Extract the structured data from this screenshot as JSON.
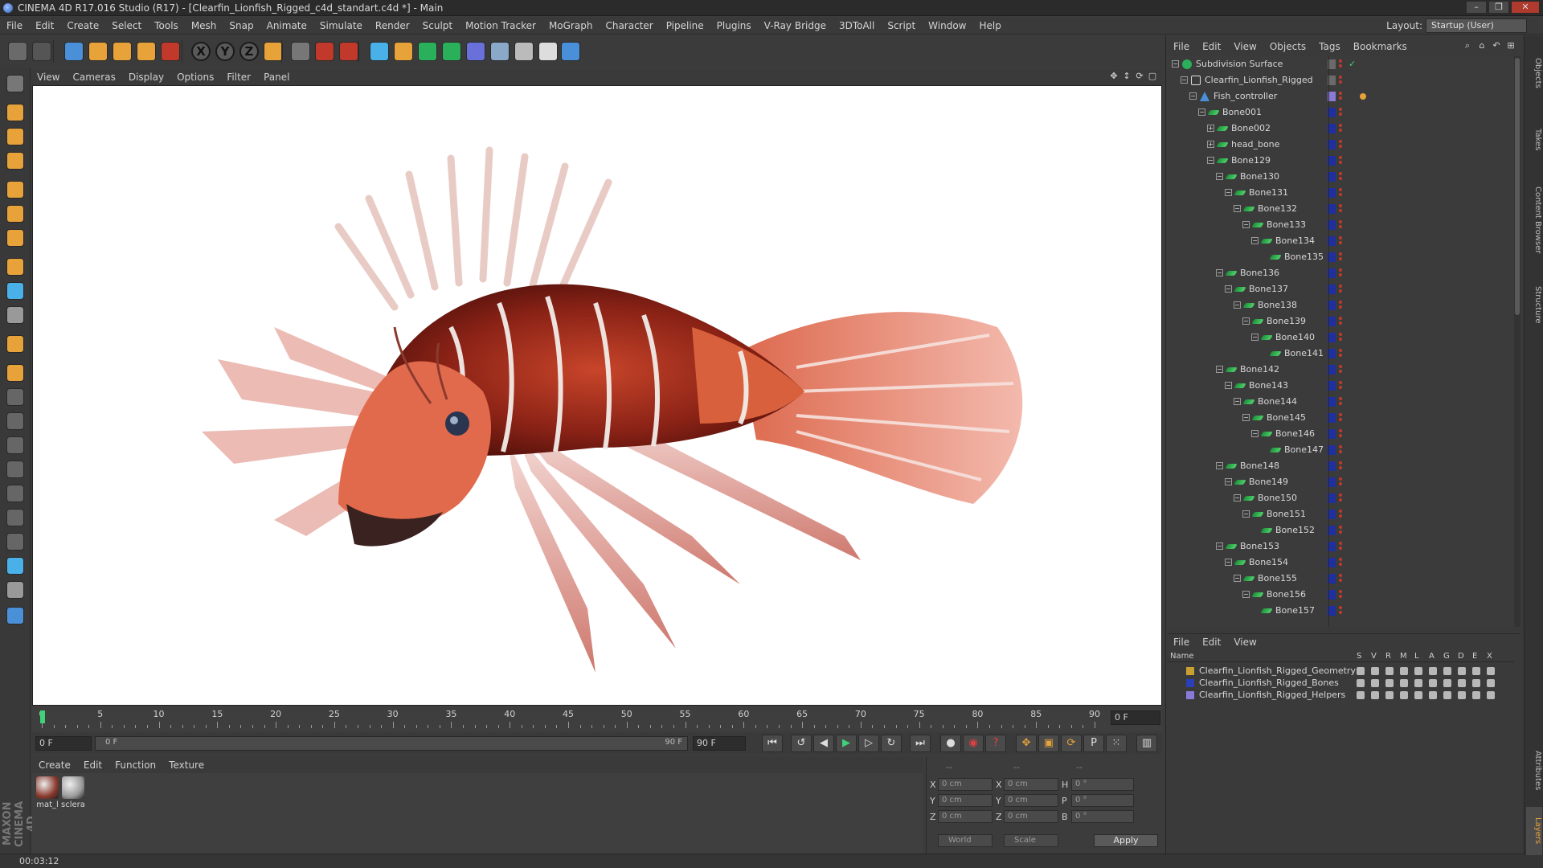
{
  "window": {
    "title": "CINEMA 4D R17.016 Studio (R17) - [Clearfin_Lionfish_Rigged_c4d_standart.c4d *] - Main",
    "buttons": [
      "–",
      "❐",
      "✕"
    ]
  },
  "menubar": {
    "items": [
      "File",
      "Edit",
      "Create",
      "Select",
      "Tools",
      "Mesh",
      "Snap",
      "Animate",
      "Simulate",
      "Render",
      "Sculpt",
      "Motion Tracker",
      "MoGraph",
      "Character",
      "Pipeline",
      "Plugins",
      "V-Ray Bridge",
      "3DToAll",
      "Script",
      "Window",
      "Help"
    ],
    "layout_label": "Layout:",
    "layout_value": "Startup (User)"
  },
  "toolbar": {
    "axis_x": "X",
    "axis_y": "Y",
    "axis_z": "Z"
  },
  "viewport": {
    "menu": [
      "View",
      "Cameras",
      "Display",
      "Options",
      "Filter",
      "Panel"
    ]
  },
  "timeline": {
    "ticks": [
      "0",
      "5",
      "10",
      "15",
      "20",
      "25",
      "30",
      "35",
      "40",
      "45",
      "50",
      "55",
      "60",
      "65",
      "70",
      "75",
      "80",
      "85",
      "90"
    ],
    "current_frame": "0 F",
    "start_field": "0 F",
    "range_start": "0 F",
    "range_end": "90 F",
    "end_field": "90 F"
  },
  "material_manager": {
    "menu": [
      "Create",
      "Edit",
      "Function",
      "Texture"
    ],
    "materials": [
      {
        "label": "mat_l",
        "color": "#8a3a2e"
      },
      {
        "label": "sclera",
        "color": "#9a9a9a"
      }
    ]
  },
  "coordinates": {
    "header": [
      "--",
      "--",
      "--"
    ],
    "rows": [
      {
        "a": "X",
        "av": "0 cm",
        "b": "X",
        "bv": "0 cm",
        "c": "H",
        "cv": "0 °"
      },
      {
        "a": "Y",
        "av": "0 cm",
        "b": "Y",
        "bv": "0 cm",
        "c": "P",
        "cv": "0 °"
      },
      {
        "a": "Z",
        "av": "0 cm",
        "b": "Z",
        "bv": "0 cm",
        "c": "B",
        "cv": "0 °"
      }
    ],
    "mode_world": "World",
    "mode_scale": "Scale",
    "apply": "Apply"
  },
  "status": {
    "time": "00:03:12"
  },
  "object_manager": {
    "menu": [
      "File",
      "Edit",
      "View",
      "Objects",
      "Tags",
      "Bookmarks"
    ],
    "objects": [
      {
        "name": "Subdivision Surface",
        "depth": 0,
        "expand": "−",
        "kind": "subdiv"
      },
      {
        "name": "Clearfin_Lionfish_Rigged",
        "depth": 1,
        "expand": "−",
        "kind": "null"
      },
      {
        "name": "Fish_controller",
        "depth": 2,
        "expand": "−",
        "kind": "ctrl"
      },
      {
        "name": "Bone001",
        "depth": 3,
        "expand": "−",
        "kind": "bone"
      },
      {
        "name": "Bone002",
        "depth": 4,
        "expand": "+",
        "kind": "bone"
      },
      {
        "name": "head_bone",
        "depth": 4,
        "expand": "+",
        "kind": "bone"
      },
      {
        "name": "Bone129",
        "depth": 4,
        "expand": "−",
        "kind": "bone"
      },
      {
        "name": "Bone130",
        "depth": 5,
        "expand": "−",
        "kind": "bone"
      },
      {
        "name": "Bone131",
        "depth": 6,
        "expand": "−",
        "kind": "bone"
      },
      {
        "name": "Bone132",
        "depth": 7,
        "expand": "−",
        "kind": "bone"
      },
      {
        "name": "Bone133",
        "depth": 8,
        "expand": "−",
        "kind": "bone"
      },
      {
        "name": "Bone134",
        "depth": 9,
        "expand": "−",
        "kind": "bone"
      },
      {
        "name": "Bone135",
        "depth": 10,
        "expand": "",
        "kind": "bone"
      },
      {
        "name": "Bone136",
        "depth": 5,
        "expand": "−",
        "kind": "bone"
      },
      {
        "name": "Bone137",
        "depth": 6,
        "expand": "−",
        "kind": "bone"
      },
      {
        "name": "Bone138",
        "depth": 7,
        "expand": "−",
        "kind": "bone"
      },
      {
        "name": "Bone139",
        "depth": 8,
        "expand": "−",
        "kind": "bone"
      },
      {
        "name": "Bone140",
        "depth": 9,
        "expand": "−",
        "kind": "bone"
      },
      {
        "name": "Bone141",
        "depth": 10,
        "expand": "",
        "kind": "bone"
      },
      {
        "name": "Bone142",
        "depth": 5,
        "expand": "−",
        "kind": "bone"
      },
      {
        "name": "Bone143",
        "depth": 6,
        "expand": "−",
        "kind": "bone"
      },
      {
        "name": "Bone144",
        "depth": 7,
        "expand": "−",
        "kind": "bone"
      },
      {
        "name": "Bone145",
        "depth": 8,
        "expand": "−",
        "kind": "bone"
      },
      {
        "name": "Bone146",
        "depth": 9,
        "expand": "−",
        "kind": "bone"
      },
      {
        "name": "Bone147",
        "depth": 10,
        "expand": "",
        "kind": "bone"
      },
      {
        "name": "Bone148",
        "depth": 5,
        "expand": "−",
        "kind": "bone"
      },
      {
        "name": "Bone149",
        "depth": 6,
        "expand": "−",
        "kind": "bone"
      },
      {
        "name": "Bone150",
        "depth": 7,
        "expand": "−",
        "kind": "bone"
      },
      {
        "name": "Bone151",
        "depth": 8,
        "expand": "−",
        "kind": "bone"
      },
      {
        "name": "Bone152",
        "depth": 9,
        "expand": "",
        "kind": "bone"
      },
      {
        "name": "Bone153",
        "depth": 5,
        "expand": "−",
        "kind": "bone"
      },
      {
        "name": "Bone154",
        "depth": 6,
        "expand": "−",
        "kind": "bone"
      },
      {
        "name": "Bone155",
        "depth": 7,
        "expand": "−",
        "kind": "bone"
      },
      {
        "name": "Bone156",
        "depth": 8,
        "expand": "−",
        "kind": "bone"
      },
      {
        "name": "Bone157",
        "depth": 9,
        "expand": "",
        "kind": "bone"
      }
    ]
  },
  "layer_manager": {
    "menu": [
      "File",
      "Edit",
      "View"
    ],
    "columns": [
      "Name",
      "S",
      "V",
      "R",
      "M",
      "L",
      "A",
      "G",
      "D",
      "E",
      "X"
    ],
    "layers": [
      {
        "name": "Clearfin_Lionfish_Rigged_Geometry",
        "color": "#c8a032"
      },
      {
        "name": "Clearfin_Lionfish_Rigged_Bones",
        "color": "#2a3fb8"
      },
      {
        "name": "Clearfin_Lionfish_Rigged_Helpers",
        "color": "#8a7ad8"
      }
    ]
  },
  "side_tabs": [
    "Objects",
    "Takes",
    "Content Browser",
    "Structure",
    "Attributes",
    "Layers"
  ]
}
